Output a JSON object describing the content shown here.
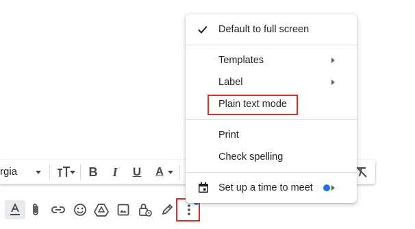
{
  "toolbar": {
    "font_name": "rgia",
    "buttons": [
      {
        "name": "font-size-button",
        "icon": "text-size-icon"
      },
      {
        "name": "bold-button",
        "icon": "bold-icon",
        "label": "B"
      },
      {
        "name": "italic-button",
        "icon": "italic-icon",
        "label": "I"
      },
      {
        "name": "underline-button",
        "icon": "underline-icon",
        "label": "U"
      },
      {
        "name": "text-color-button",
        "icon": "text-color-icon",
        "label": "A"
      },
      {
        "name": "remove-formatting-button",
        "icon": "remove-format-icon"
      }
    ]
  },
  "action_bar": {
    "buttons": [
      {
        "name": "formatting-options-button",
        "icon": "format-text-icon",
        "active": true
      },
      {
        "name": "attach-files-button",
        "icon": "paperclip-icon"
      },
      {
        "name": "insert-link-button",
        "icon": "link-icon"
      },
      {
        "name": "insert-emoji-button",
        "icon": "emoji-icon"
      },
      {
        "name": "insert-drive-button",
        "icon": "drive-icon"
      },
      {
        "name": "insert-photo-button",
        "icon": "photo-icon"
      },
      {
        "name": "confidential-mode-button",
        "icon": "lock-clock-icon"
      },
      {
        "name": "insert-signature-button",
        "icon": "pen-icon"
      },
      {
        "name": "more-options-button",
        "icon": "more-vert-icon"
      }
    ]
  },
  "menu": {
    "items": [
      {
        "label": "Default to full screen",
        "checked": true
      },
      {
        "label": "Templates",
        "submenu": true
      },
      {
        "label": "Label",
        "submenu": true
      },
      {
        "label": "Plain text mode"
      },
      {
        "label": "Print"
      },
      {
        "label": "Check spelling"
      },
      {
        "label": "Set up a time to meet",
        "icon": "calendar-icon",
        "submenu": true
      }
    ]
  },
  "colors": {
    "accent": "#1a73e8",
    "highlight": "#d93025",
    "icon": "#444746"
  }
}
